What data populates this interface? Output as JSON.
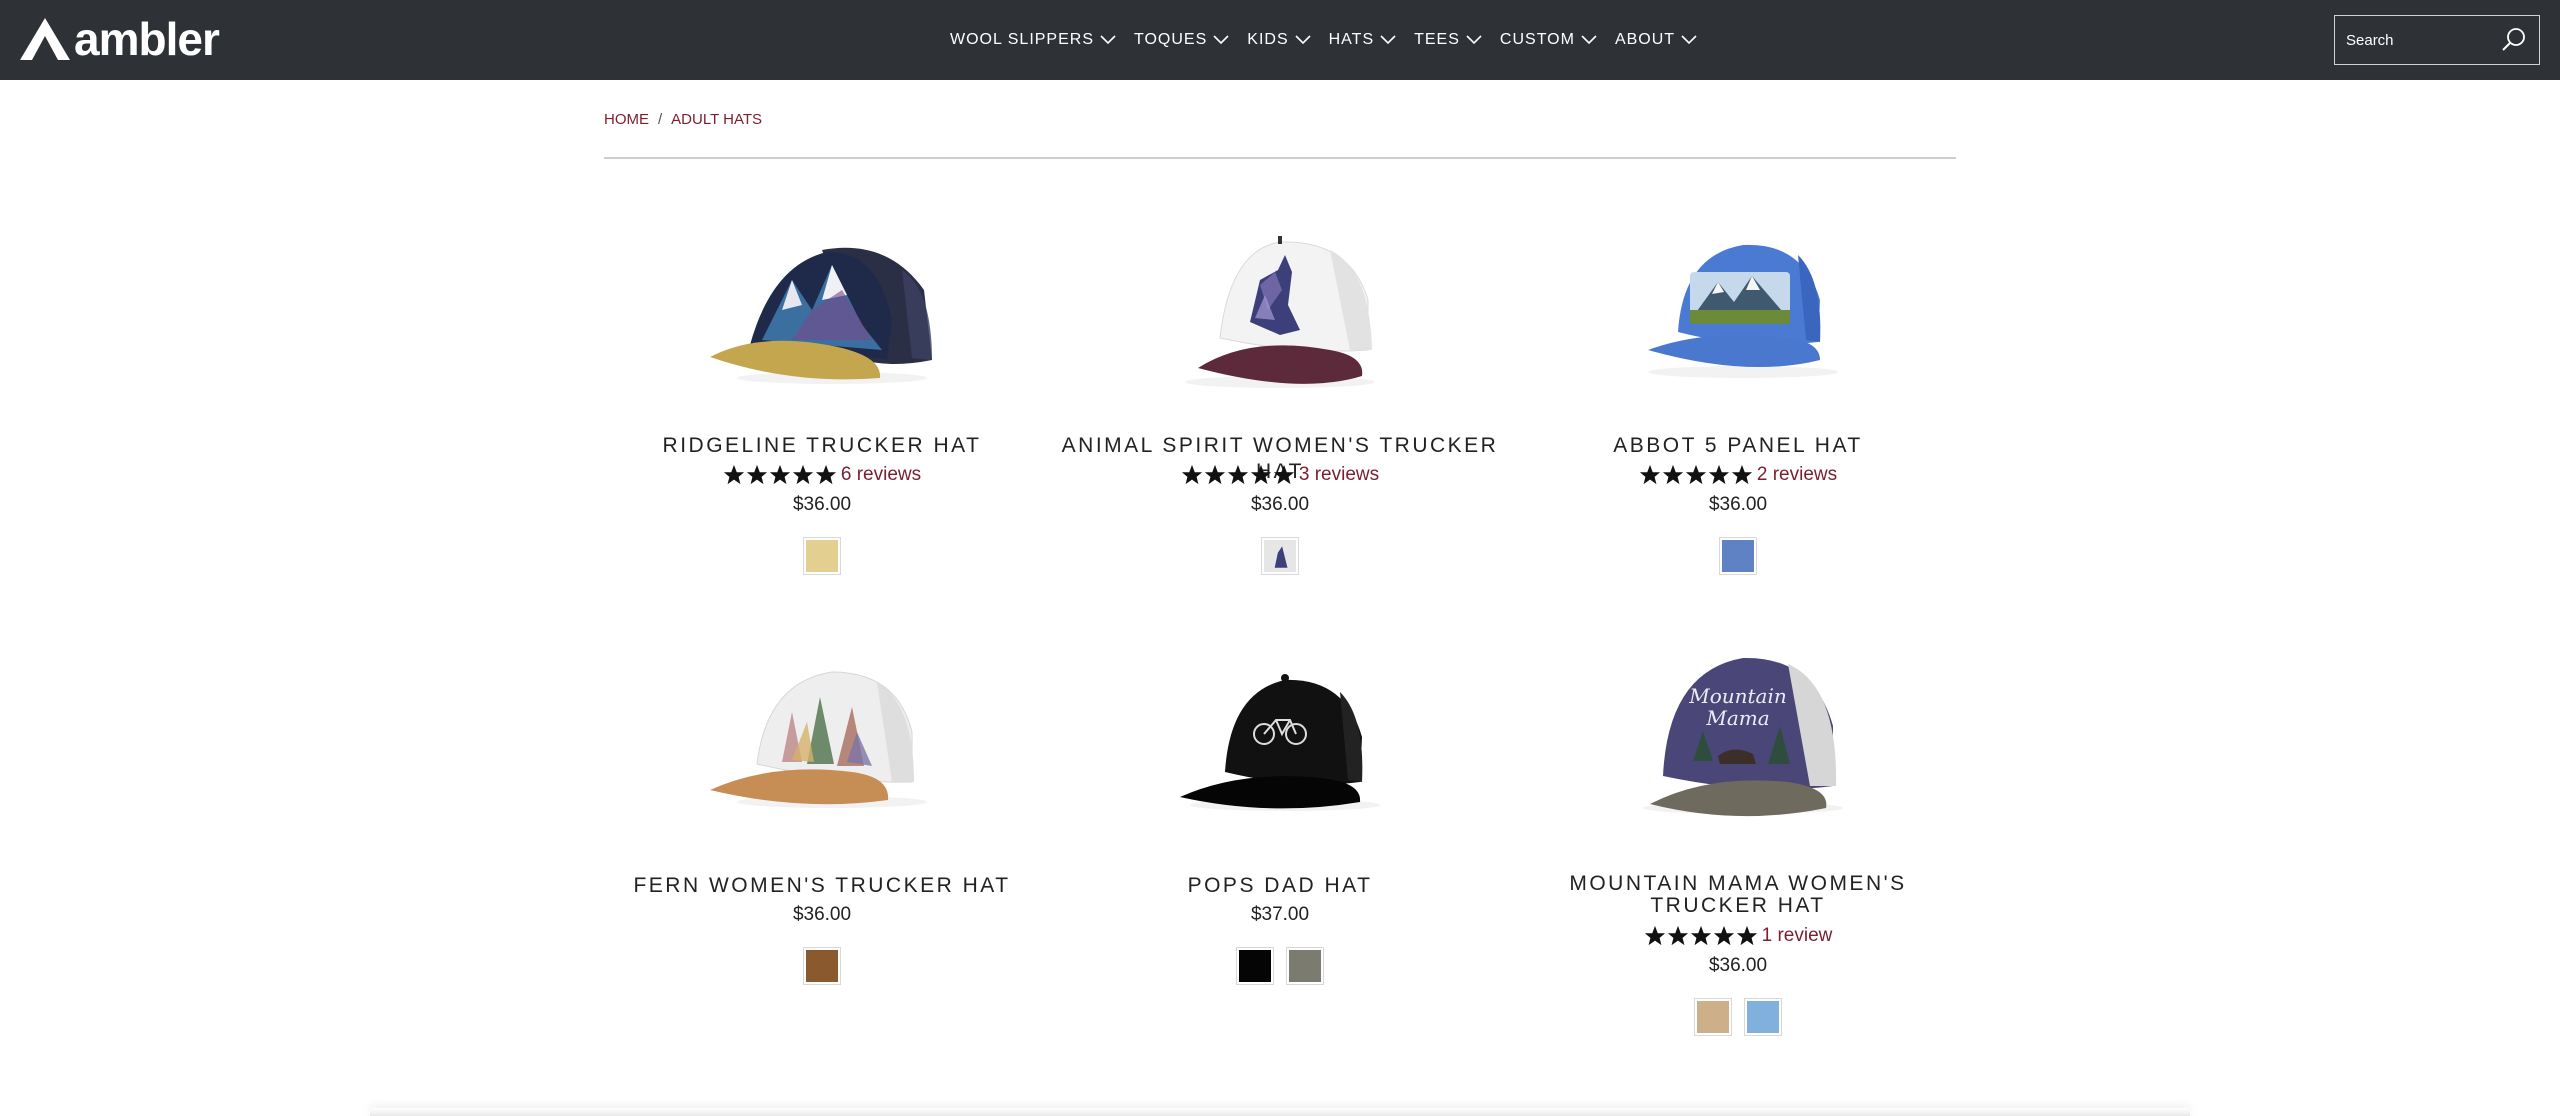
{
  "header": {
    "logo_text": "ambler",
    "nav": [
      {
        "label": "WOOL SLIPPERS"
      },
      {
        "label": "TOQUES"
      },
      {
        "label": "KIDS"
      },
      {
        "label": "HATS"
      },
      {
        "label": "TEES"
      },
      {
        "label": "CUSTOM"
      },
      {
        "label": "ABOUT"
      }
    ],
    "search": {
      "placeholder": "Search"
    }
  },
  "breadcrumb": {
    "home": "HOME",
    "separator": "/",
    "current": "ADULT HATS"
  },
  "products": [
    {
      "title": "RIDGELINE TRUCKER HAT",
      "rating": 5,
      "reviews": "6 reviews",
      "price": "$36.00",
      "swatches": [
        "#e3cf8f"
      ]
    },
    {
      "title": "ANIMAL SPIRIT WOMEN'S TRUCKER HAT",
      "rating": 5,
      "reviews": "3 reviews",
      "price": "$36.00",
      "swatches": [
        "#dcdcdc"
      ]
    },
    {
      "title": "ABBOT 5 PANEL HAT",
      "rating": 5,
      "reviews": "2 reviews",
      "price": "$36.00",
      "swatches": [
        "#5e82c4"
      ]
    },
    {
      "title": "FERN WOMEN'S TRUCKER HAT",
      "rating": null,
      "reviews": null,
      "price": "$36.00",
      "swatches": [
        "#8a5a2e"
      ]
    },
    {
      "title": "POPS DAD HAT",
      "rating": null,
      "reviews": null,
      "price": "$37.00",
      "swatches": [
        "#050505",
        "#7c7b70"
      ]
    },
    {
      "title": "MOUNTAIN MAMA WOMEN'S TRUCKER HAT",
      "rating": 5,
      "reviews": "1 review",
      "price": "$36.00",
      "swatches": [
        "#cdb08a",
        "#82b0dc"
      ]
    }
  ],
  "colors": {
    "header_bg": "#2e3236",
    "accent": "#7a1f2f",
    "text": "#222222"
  }
}
